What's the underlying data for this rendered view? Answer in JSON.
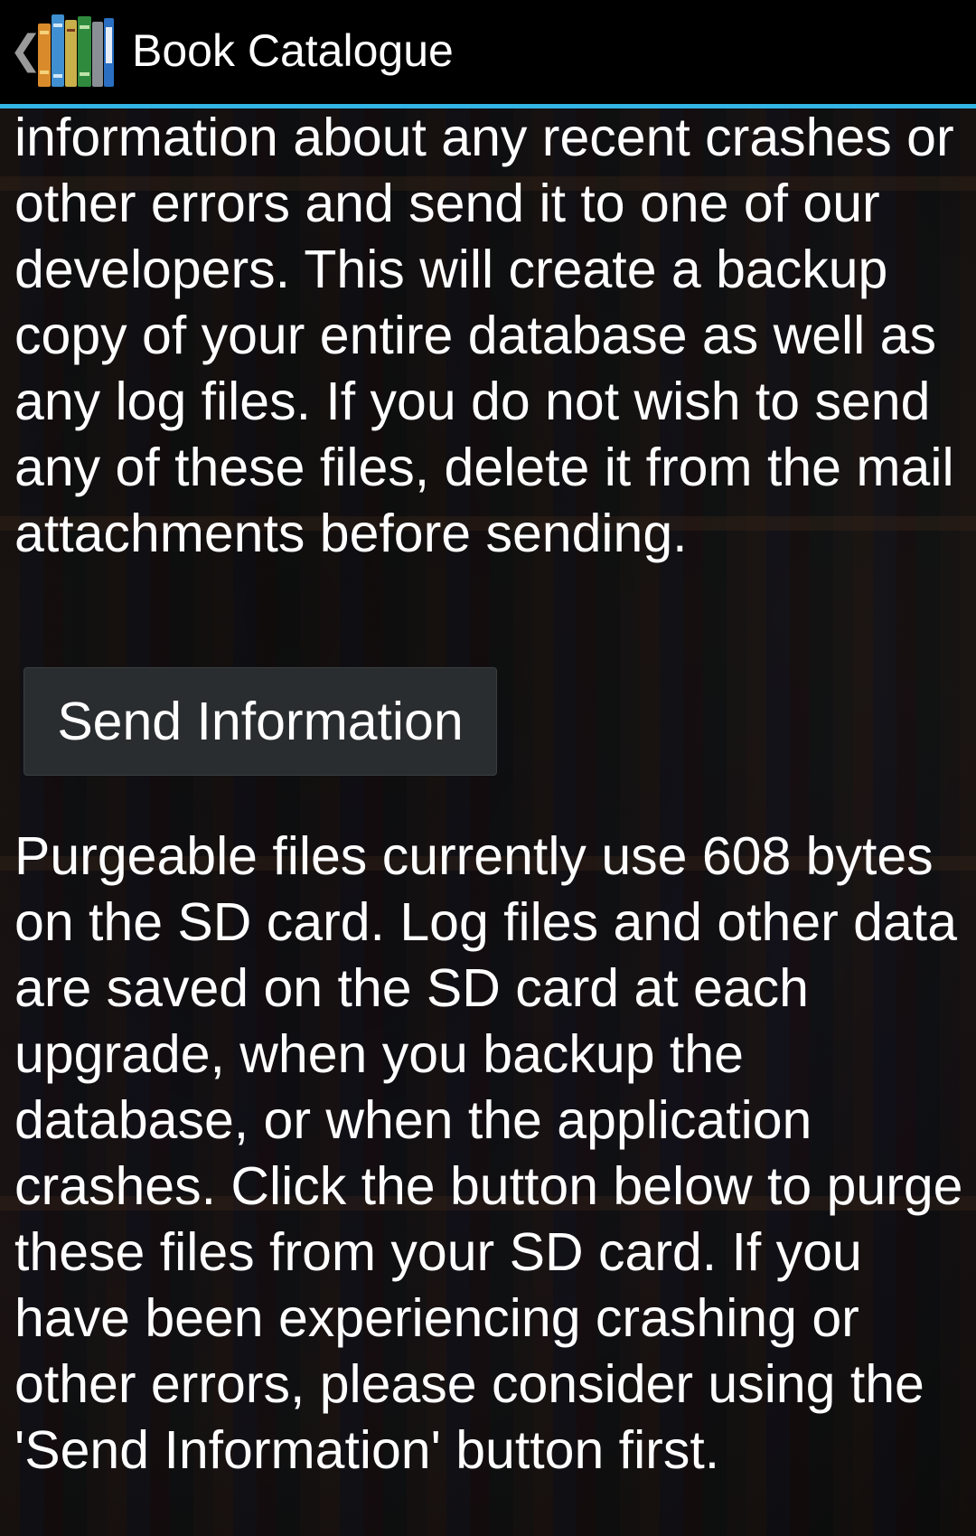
{
  "action_bar": {
    "title": "Book Catalogue",
    "up_icon": "chevron-left-icon",
    "app_icon": "book-catalogue-app-icon"
  },
  "content": {
    "crash_info_text": "Click on the button below to gather information about any recent crashes or other errors and send it to one of our developers. This will create a backup copy of your entire database as well as any log files. If you do not wish to send any of these files, delete it from the mail attachments before sending.",
    "send_button_label": "Send Information",
    "purge_info_text": "Purgeable files currently use 608 bytes on the SD card. Log files and other data are saved on the SD card at each upgrade, when you backup the database, or when the application crashes. Click the button below to purge these files from your SD card. If you have been experiencing crashing or other errors, please consider using the 'Send Information' button first."
  },
  "colors": {
    "action_bar_background": "#000000",
    "action_bar_underline": "#33b5e5",
    "text": "#ffffff",
    "button_background": "#2a2d2f"
  }
}
